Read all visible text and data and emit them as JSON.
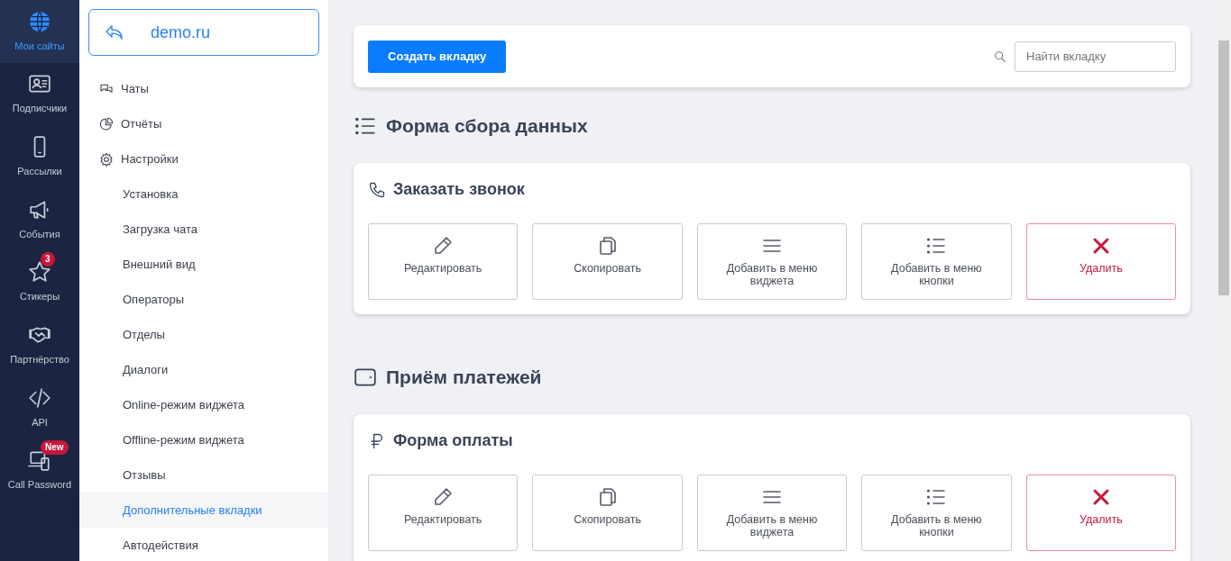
{
  "rail": [
    {
      "kind": "globe",
      "label": "Мои сайты",
      "selected": true
    },
    {
      "kind": "contact",
      "label": "Подписчики",
      "selected": false
    },
    {
      "kind": "phone",
      "label": "Рассылки",
      "selected": false
    },
    {
      "kind": "megaphone",
      "label": "События",
      "selected": false
    },
    {
      "kind": "star",
      "label": "Стикеры",
      "selected": false,
      "badge": "3"
    },
    {
      "kind": "handshake",
      "label": "Партнёрство",
      "selected": false
    },
    {
      "kind": "code",
      "label": "API",
      "selected": false
    },
    {
      "kind": "devices",
      "label": "Call Password",
      "selected": false,
      "badge": "New"
    }
  ],
  "site": {
    "name": "demo.ru"
  },
  "menu": [
    {
      "kind": "chats",
      "label": "Чаты",
      "selected": false
    },
    {
      "kind": "chart",
      "label": "Отчёты",
      "selected": false
    },
    {
      "kind": "gear",
      "label": "Настройки",
      "selected": false
    },
    {
      "kind": "sub",
      "label": "Установка",
      "selected": false
    },
    {
      "kind": "sub",
      "label": "Загрузка чата",
      "selected": false
    },
    {
      "kind": "sub",
      "label": "Внешний вид",
      "selected": false
    },
    {
      "kind": "sub",
      "label": "Операторы",
      "selected": false
    },
    {
      "kind": "sub",
      "label": "Отделы",
      "selected": false
    },
    {
      "kind": "sub",
      "label": "Диалоги",
      "selected": false
    },
    {
      "kind": "sub",
      "label": "Online-режим виджета",
      "selected": false
    },
    {
      "kind": "sub",
      "label": "Offline-режим виджета",
      "selected": false
    },
    {
      "kind": "sub",
      "label": "Отзывы",
      "selected": false
    },
    {
      "kind": "sub",
      "label": "Дополнительные вкладки",
      "selected": true
    },
    {
      "kind": "sub",
      "label": "Автодействия",
      "selected": false
    }
  ],
  "toolbar": {
    "create_button": "Создать вкладку",
    "search": {
      "placeholder": "Найти вкладку"
    }
  },
  "sections": [
    {
      "kind": "form",
      "title": "Форма сбора данных",
      "cards": [
        {
          "kind": "call",
          "title": "Заказать звонок",
          "actions": [
            {
              "kind": "edit",
              "label": "Редактировать"
            },
            {
              "kind": "copy",
              "label": "Скопировать"
            },
            {
              "kind": "menu",
              "label": "Добавить в меню виджета"
            },
            {
              "kind": "list",
              "label": "Добавить в меню кнопки"
            },
            {
              "kind": "delete",
              "label": "Удалить"
            }
          ]
        }
      ]
    },
    {
      "kind": "payment",
      "title": "Приём платежей",
      "cards": [
        {
          "kind": "ruble",
          "title": "Форма оплаты",
          "actions": [
            {
              "kind": "edit",
              "label": "Редактировать"
            },
            {
              "kind": "copy",
              "label": "Скопировать"
            },
            {
              "kind": "menu",
              "label": "Добавить в меню виджета"
            },
            {
              "kind": "list",
              "label": "Добавить в меню кнопки"
            },
            {
              "kind": "delete",
              "label": "Удалить"
            }
          ]
        }
      ]
    }
  ]
}
